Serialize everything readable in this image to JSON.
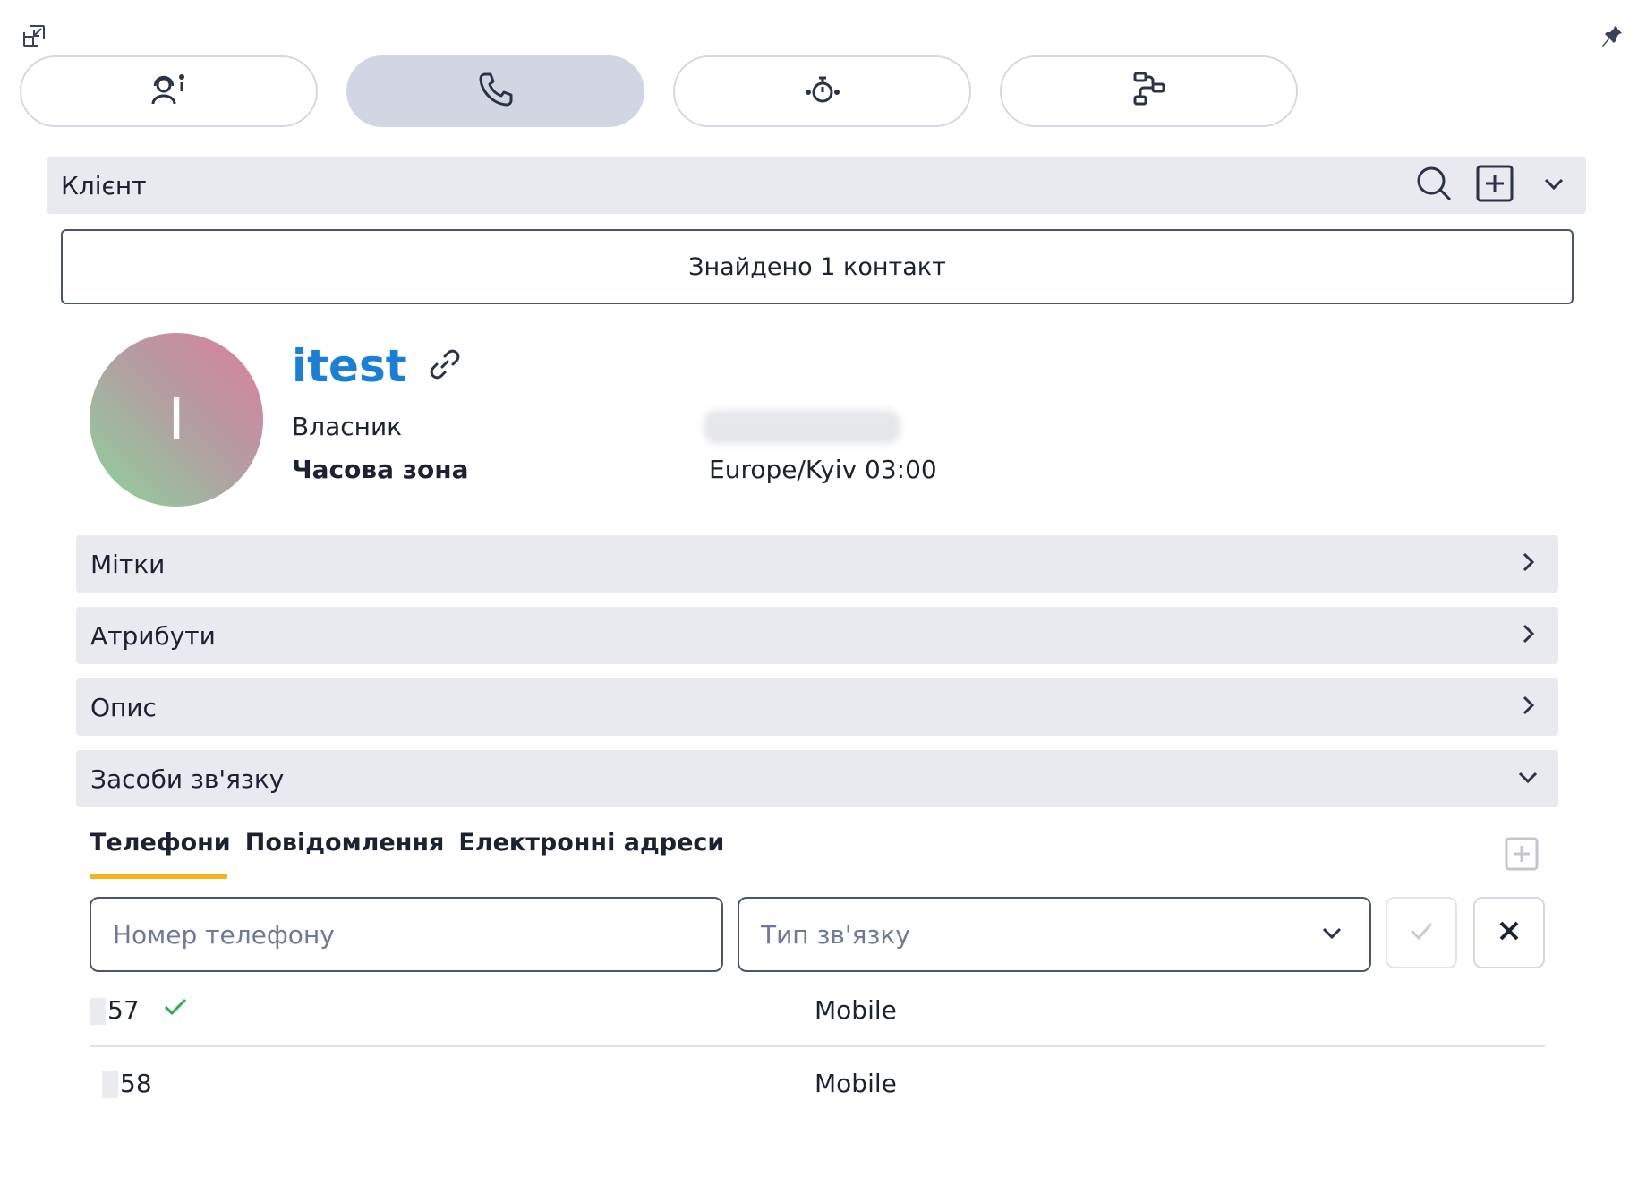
{
  "window": {
    "collapse_icon": "collapse-icon",
    "pin_icon": "pin-icon"
  },
  "tabs": [
    {
      "icon": "agent-info-icon",
      "active": false
    },
    {
      "icon": "phone-icon",
      "active": true
    },
    {
      "icon": "stopwatch-icon",
      "active": false
    },
    {
      "icon": "flow-icon",
      "active": false
    }
  ],
  "client": {
    "title": "Клієнт",
    "found_text": "Знайдено 1 контакт"
  },
  "contact": {
    "initial": "I",
    "name": "itest",
    "owner_label": "Власник",
    "timezone_label": "Часова зона",
    "timezone_value": "Europe/Kyiv 03:00"
  },
  "sections": {
    "tags": "Мітки",
    "attributes": "Атрибути",
    "description": "Опис",
    "communications": "Засоби зв'язку"
  },
  "comm_tabs": {
    "phones": "Телефони",
    "messages": "Повідомлення",
    "emails": "Електронні адреси"
  },
  "form": {
    "phone_placeholder": "Номер телефону",
    "type_placeholder": "Тип зв'язку"
  },
  "phones": [
    {
      "number": "57",
      "type": "Mobile",
      "primary": true
    },
    {
      "number": "58",
      "type": "Mobile",
      "primary": false
    }
  ],
  "colors": {
    "accent": "#1a7fd6",
    "tab_underline": "#f3b51b",
    "check": "#2eab4b"
  }
}
